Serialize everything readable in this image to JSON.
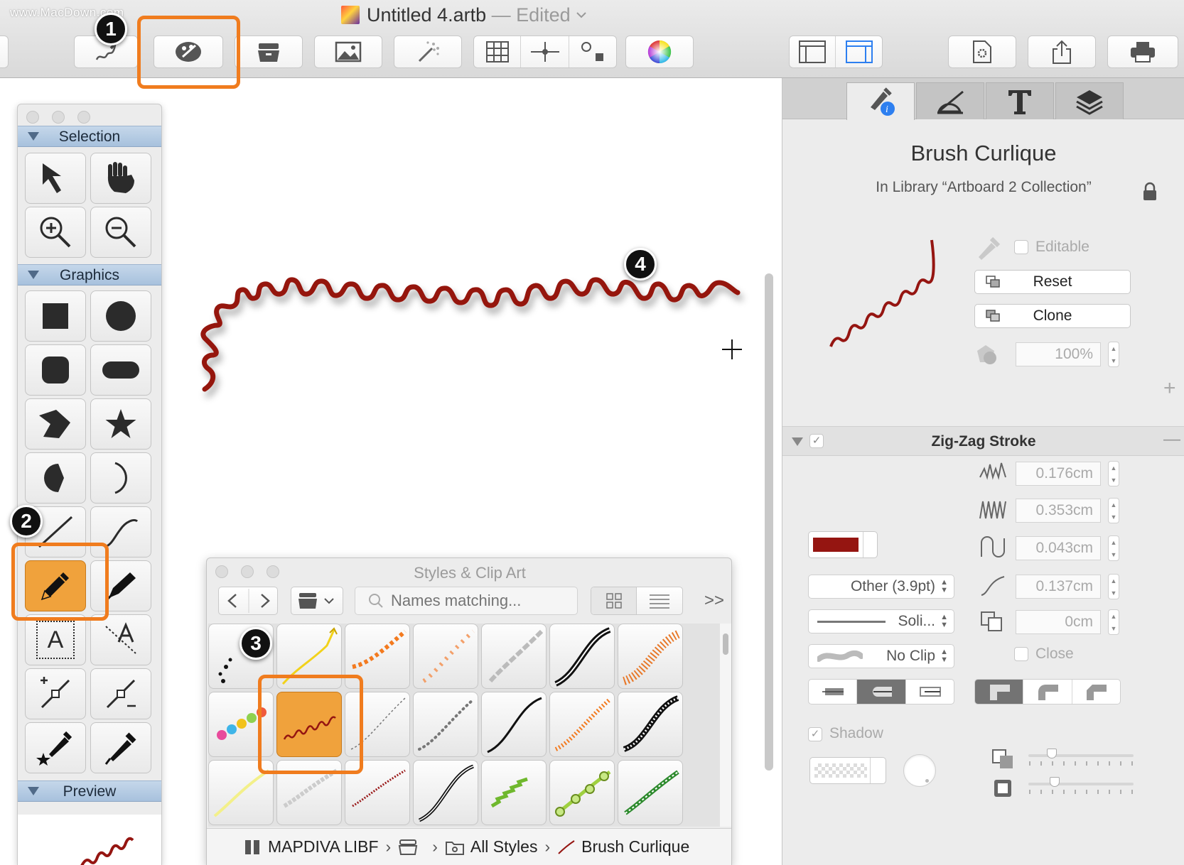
{
  "watermark": "www.MacDown.com",
  "window": {
    "title": "Untitled 4.artb",
    "status": "— Edited"
  },
  "callouts": [
    "1",
    "2",
    "3",
    "4"
  ],
  "toolbar": {
    "buttons": [
      "freehand-icon",
      "style-palette-icon",
      "library-icon",
      "image-icon",
      "magic-wand-icon",
      "grid-icon",
      "guides-icon",
      "snap-icon",
      "color-wheel-icon",
      "layout-left-icon",
      "layout-right-icon",
      "document-settings-icon",
      "share-icon",
      "print-icon"
    ]
  },
  "tools_palette": {
    "sections": {
      "selection": "Selection",
      "graphics": "Graphics",
      "preview": "Preview"
    },
    "text_tool_glyph": "A"
  },
  "styles_panel": {
    "title": "Styles & Clip Art",
    "search_placeholder": "Names matching...",
    "more": ">>",
    "path": [
      "MAPDIVA LIBF",
      "All Styles",
      "Brush Curlique"
    ]
  },
  "inspector": {
    "style_name": "Brush Curlique",
    "library_line": "In Library “Artboard 2 Collection”",
    "editable_label": "Editable",
    "reset_label": "Reset",
    "clone_label": "Clone",
    "opacity": "100%",
    "section_title": "Zig-Zag Stroke",
    "fields": [
      "0.176cm",
      "0.353cm",
      "0.043cm",
      "0.137cm",
      "0cm"
    ],
    "stroke_width": "Other (3.9pt)",
    "dash": "Soli...",
    "clip": "No Clip",
    "close_label": "Close",
    "shadow_label": "Shadow",
    "stroke_color": "#951511",
    "add": "+",
    "remove": "—"
  },
  "colors": {
    "accent_orange": "#f07c1e",
    "selected_fill": "#f0a23c",
    "curve_red": "#951511"
  }
}
